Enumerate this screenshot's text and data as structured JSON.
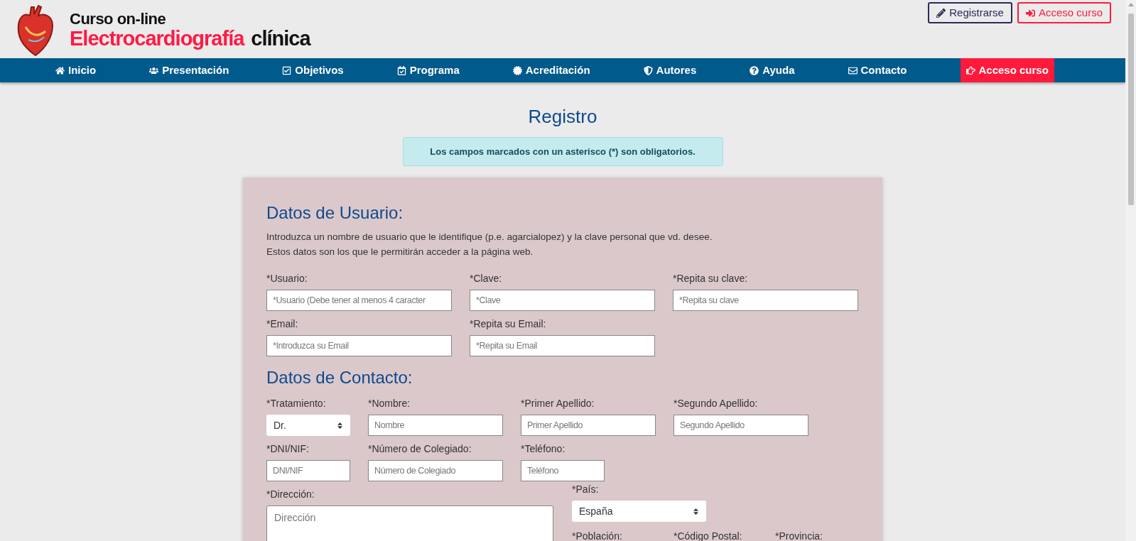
{
  "logo": {
    "line_1": "Curso on-line",
    "line_2_red": "Electrocardiografía",
    "line_2_dark": "clínica"
  },
  "top_buttons": [
    {
      "label": "Registrarse",
      "kind": "outline-dark"
    },
    {
      "label": "Acceso curso",
      "kind": "outline-red"
    }
  ],
  "nav": [
    {
      "label": "Inicio",
      "kind": "link"
    },
    {
      "label": "Presentación",
      "kind": "link"
    },
    {
      "label": "Objetivos",
      "kind": "link"
    },
    {
      "label": "Programa",
      "kind": "link"
    },
    {
      "label": "Acreditación",
      "kind": "link"
    },
    {
      "label": "Autores",
      "kind": "link"
    },
    {
      "label": "Ayuda",
      "kind": "link"
    },
    {
      "label": "Contacto",
      "kind": "link"
    },
    {
      "label": "Acceso curso",
      "kind": "cta"
    }
  ],
  "page_title": "Registro",
  "notice": "Los campos marcados con un asterisco (*) son obligatorios.",
  "user_section": {
    "title": "Datos de Usuario:",
    "intro": [
      "Introduzca un nombre de usuario que le identifique (p.e. agarcialopez) y la clave personal que vd. desee.",
      "Estos datos son los que le permitirán acceder a la página web."
    ],
    "rows": [
      [
        {
          "label": "*Usuario:",
          "placeholder": "*Usuario (Debe tener al menos 4 caracter",
          "kind": "input"
        },
        {
          "label": "*Clave:",
          "placeholder": "*Clave",
          "kind": "input"
        },
        {
          "label": "*Repita su clave:",
          "placeholder": "*Repita su clave",
          "kind": "input"
        }
      ],
      [
        {
          "label": "*Email:",
          "placeholder": "*Introduzca su Email",
          "kind": "input"
        },
        {
          "label": "*Repita su Email:",
          "placeholder": "*Repita su Email",
          "kind": "input"
        }
      ]
    ]
  },
  "contact_section": {
    "title": "Datos de Contacto:",
    "rows": [
      [
        {
          "label": "*Tratamiento:",
          "value": "Dr.",
          "kind": "select"
        },
        {
          "label": "*Nombre:",
          "placeholder": "Nombre",
          "kind": "input"
        },
        {
          "label": "*Primer Apellido:",
          "placeholder": "Primer Apellido",
          "kind": "input"
        },
        {
          "label": "*Segundo Apellido:",
          "placeholder": "Segundo Apellido",
          "kind": "input"
        }
      ],
      [
        {
          "label": "*DNI/NIF:",
          "placeholder": "DNI/NIF",
          "kind": "input"
        },
        {
          "label": "*Número de Colegiado:",
          "placeholder": "Número de Colegiado",
          "kind": "input"
        },
        {
          "label": "*Teléfono:",
          "placeholder": "Teléfono",
          "kind": "input"
        }
      ]
    ],
    "address": {
      "label": "*Dirección:",
      "placeholder": "Dirección"
    },
    "country": {
      "label": "*País:",
      "value": "España"
    },
    "more_labels": [
      "*Población:",
      "*Código Postal:",
      "*Provincia:"
    ]
  }
}
